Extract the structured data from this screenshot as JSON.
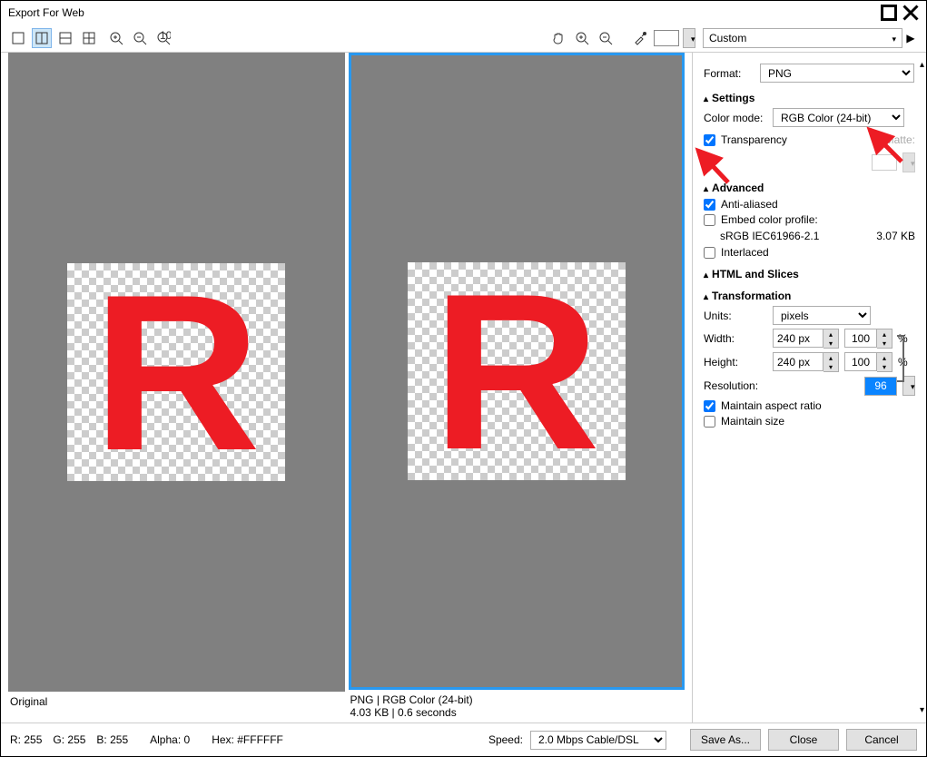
{
  "window": {
    "title": "Export For Web"
  },
  "toolbar": {
    "preset": "Custom"
  },
  "previews": {
    "left": {
      "caption_line1": "Original",
      "caption_line2": ""
    },
    "right": {
      "caption_line1": "PNG  |  RGB Color (24-bit)",
      "caption_line2": "4.03 KB  |  0.6 seconds"
    }
  },
  "side": {
    "format_label": "Format:",
    "format_value": "PNG",
    "settings": {
      "head": "Settings",
      "colormode_label": "Color mode:",
      "colormode_value": "RGB Color (24-bit)",
      "transparency_label": "Transparency",
      "matte_label": "Matte:"
    },
    "advanced": {
      "head": "Advanced",
      "anti_label": "Anti-aliased",
      "embed_label": "Embed color profile:",
      "profile_name": "sRGB IEC61966-2.1",
      "profile_size": "3.07 KB",
      "interlaced_label": "Interlaced"
    },
    "html": {
      "head": "HTML and Slices"
    },
    "transform": {
      "head": "Transformation",
      "units_label": "Units:",
      "units_value": "pixels",
      "width_label": "Width:",
      "width_value": "240 px",
      "width_pct": "100",
      "pct": "%",
      "height_label": "Height:",
      "height_value": "240 px",
      "height_pct": "100",
      "resolution_label": "Resolution:",
      "resolution_value": "96",
      "maintain_ratio": "Maintain aspect ratio",
      "maintain_size": "Maintain size"
    }
  },
  "bottom": {
    "r_label": "R:",
    "r": "255",
    "g_label": "G:",
    "g": "255",
    "b_label": "B:",
    "b": "255",
    "alpha_label": "Alpha:",
    "alpha": "0",
    "hex_label": "Hex:",
    "hex": "#FFFFFF",
    "speed_label": "Speed:",
    "speed_value": "2.0 Mbps Cable/DSL",
    "save": "Save As...",
    "close": "Close",
    "cancel": "Cancel"
  }
}
